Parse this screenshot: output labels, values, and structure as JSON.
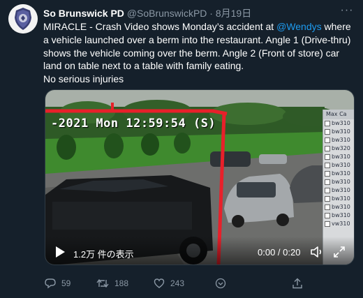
{
  "tweet": {
    "author_name": "So Brunswick PD",
    "author_handle": "@SoBrunswickPD",
    "separator": "·",
    "date": "8月19日",
    "more_glyph": "···",
    "text_part1": "MIRACLE - Crash Video shows Monday’s accident at ",
    "mention": "@Wendys",
    "text_part2": " where a vehicle launched over a berm into the restaurant. Angle 1 (Drive-thru) shows the vehicle coming over the berm. Angle 2 (Front of store) car land on table next to a table with family eating.",
    "text_line_last": "No serious injuries"
  },
  "video": {
    "osd_timestamp": "-2021 Mon 12:59:54 (S)",
    "camera_panel_header": "Max Ca",
    "camera_list": [
      "bw310",
      "bw310",
      "bw310",
      "bw320",
      "bw310",
      "bw310",
      "bw310",
      "bw310",
      "bw310",
      "bw310",
      "bw310",
      "bw310",
      "vw310"
    ],
    "view_count": "1.2万 件の表示",
    "time_display": "0:00 / 0:20"
  },
  "actions": {
    "replies": "59",
    "retweets": "188",
    "likes": "243"
  },
  "colors": {
    "background": "#15202b",
    "secondary_text": "#8b98a5",
    "link": "#1d9bf0",
    "highlight_red": "#e8202a"
  },
  "icons": {
    "more": "more-horizontal-icon",
    "play": "play-icon",
    "volume": "volume-icon",
    "fullscreen": "fullscreen-icon",
    "reply": "reply-icon",
    "retweet": "retweet-icon",
    "like": "heart-icon",
    "share": "share-icon",
    "badge": "police-badge-icon"
  }
}
